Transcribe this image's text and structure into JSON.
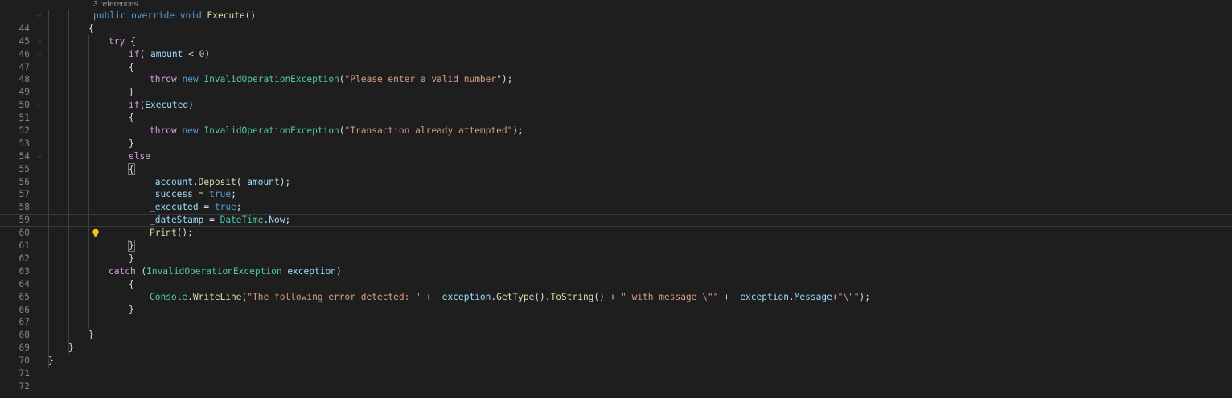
{
  "codelens": "3 references",
  "current_line": 60,
  "lines": [
    {
      "n": "44",
      "fold": true
    },
    {
      "n": "45"
    },
    {
      "n": "46",
      "fold": true
    },
    {
      "n": "47",
      "fold": true
    },
    {
      "n": "48"
    },
    {
      "n": "49"
    },
    {
      "n": "50"
    },
    {
      "n": "51",
      "fold": true
    },
    {
      "n": "52"
    },
    {
      "n": "53"
    },
    {
      "n": "54"
    },
    {
      "n": "55",
      "fold": true
    },
    {
      "n": "56"
    },
    {
      "n": "57"
    },
    {
      "n": "58"
    },
    {
      "n": "59"
    },
    {
      "n": "60"
    },
    {
      "n": "61"
    },
    {
      "n": "62"
    },
    {
      "n": "63"
    },
    {
      "n": "64"
    },
    {
      "n": "65"
    },
    {
      "n": "66"
    },
    {
      "n": "67"
    },
    {
      "n": "68"
    },
    {
      "n": "69"
    },
    {
      "n": "70"
    },
    {
      "n": "71"
    },
    {
      "n": "72"
    }
  ],
  "code": {
    "l44": {
      "a": "public",
      "b": "override",
      "c": "void",
      "d": "Execute",
      "e": "()"
    },
    "l45": "{",
    "l46": {
      "a": "try",
      "b": " {"
    },
    "l47": {
      "a": "if",
      "b": "(",
      "c": "_amount",
      "d": " < ",
      "e": "0",
      "f": ")"
    },
    "l48": "{",
    "l49": {
      "a": "throw",
      "b": "new",
      "c": "InvalidOperationException",
      "d": "(",
      "e": "\"Please enter a valid number\"",
      "f": ");"
    },
    "l50": "}",
    "l51": {
      "a": "if",
      "b": "(",
      "c": "Executed",
      "d": ")"
    },
    "l52": "{",
    "l53": {
      "a": "throw",
      "b": "new",
      "c": "InvalidOperationException",
      "d": "(",
      "e": "\"Transaction already attempted\"",
      "f": ");"
    },
    "l54": "}",
    "l55": "else",
    "l56": "{",
    "l57": {
      "a": "_account",
      "b": ".",
      "c": "Deposit",
      "d": "(",
      "e": "_amount",
      "f": ");"
    },
    "l58": {
      "a": "_success",
      "b": " = ",
      "c": "true",
      "d": ";"
    },
    "l59": {
      "a": "_executed",
      "b": " = ",
      "c": "true",
      "d": ";"
    },
    "l60": {
      "a": "_dateStamp",
      "b": " = ",
      "c": "DateTime",
      "d": ".",
      "e": "Now",
      "f": ";"
    },
    "l61": {
      "a": "Print",
      "b": "();"
    },
    "l62": "}",
    "l63": "}",
    "l64": {
      "a": "catch",
      "b": " (",
      "c": "InvalidOperationException",
      "d": " ",
      "e": "exception",
      "f": ")"
    },
    "l65": "{",
    "l66": {
      "a": "Console",
      "b": ".",
      "c": "WriteLine",
      "d": "(",
      "e": "\"The following error detected: \"",
      "f": " +  ",
      "g": "exception",
      "h": ".",
      "i": "GetType",
      "j": "().",
      "k": "ToString",
      "l": "() + ",
      "m": "\" with message \\\"\"",
      "n": " +  ",
      "o": "exception",
      "p": ".",
      "q": "Message",
      "r": "+",
      "s": "\"\\\"\"",
      "t": ");"
    },
    "l67": "}",
    "l69": "}",
    "l70": "}",
    "l71": "}"
  },
  "colors": {
    "background": "#1e1e1e",
    "keyword": "#569cd6",
    "control_keyword": "#d8a0df",
    "method": "#dcdcaa",
    "type": "#4ec9b0",
    "string": "#d69d85",
    "variable": "#9cdcfe",
    "number": "#b5cea8",
    "line_number": "#858585"
  },
  "icons": {
    "lightbulb": "lightbulb-icon",
    "fold": "chevron-down-icon"
  }
}
